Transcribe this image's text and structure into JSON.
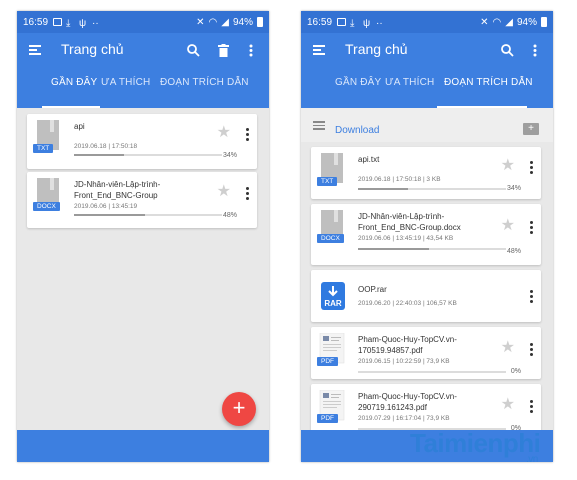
{
  "status": {
    "time": "16:59",
    "battery": "94%"
  },
  "app": {
    "title": "Trang chủ"
  },
  "tabs": [
    "GẦN ĐÂY",
    "ƯA THÍCH",
    "ĐOẠN TRÍCH DẪN"
  ],
  "left": {
    "files": [
      {
        "name": "api",
        "meta": "2019.06.18 | 17:50:18",
        "percent": "34%",
        "badge": "TXT",
        "progress": 0.34
      },
      {
        "name": "JD-Nhân-viên-Lập-trình-Front_End_BNC-Group",
        "meta": "2019.06.06 | 13:45:19",
        "percent": "48%",
        "badge": "DOCX",
        "progress": 0.48
      }
    ],
    "fab": "+"
  },
  "right": {
    "folder": "Download",
    "files": [
      {
        "name": "api.txt",
        "meta": "2019.06.18 | 17:50:18 | 3 KB",
        "percent": "34%",
        "badge": "TXT",
        "progress": 0.34
      },
      {
        "name": "JD-Nhân-viên-Lập-trình-Front_End_BNC-Group.docx",
        "meta": "2019.06.06 | 13:45:19 | 43,54 KB",
        "percent": "48%",
        "badge": "DOCX",
        "progress": 0.48
      },
      {
        "name": "OOP.rar",
        "meta": "2019.06.20 | 22:40:03 | 106,57 KB",
        "badge": "RAR"
      },
      {
        "name": "Pham-Quoc-Huy-TopCV.vn-170519.94857.pdf",
        "meta": "2019.06.15 | 10:22:59 | 73,9 KB",
        "percent": "0%",
        "badge": "PDF",
        "progress": 0
      },
      {
        "name": "Pham-Quoc-Huy-TopCV.vn-290719.161243.pdf",
        "meta": "2019.07.29 | 16:17:04 | 73,9 KB",
        "percent": "0%",
        "badge": "PDF",
        "progress": 0
      }
    ]
  },
  "watermark": {
    "main": "Taimienphi",
    "suffix": ".vn"
  },
  "colors": {
    "primary": "#3d7fe0",
    "fab": "#ef4743",
    "background": "#e8e8e8"
  }
}
